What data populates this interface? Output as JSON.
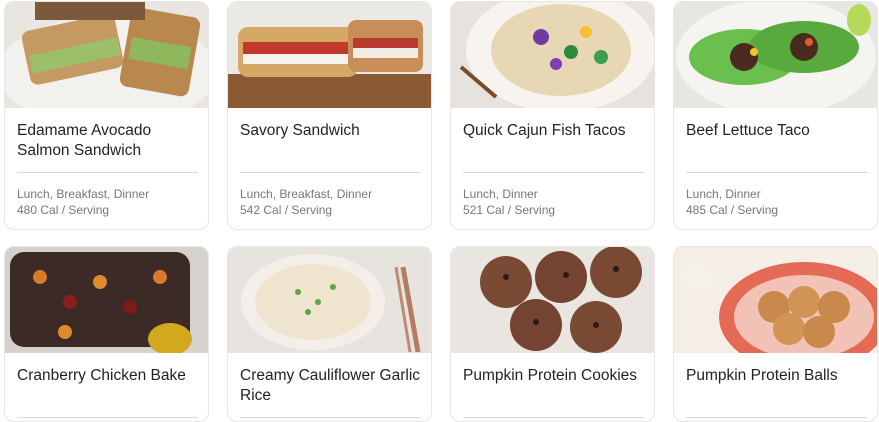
{
  "recipes": [
    {
      "title": "Edamame Avocado Salmon Sandwich",
      "categories": "Lunch, Breakfast, Dinner",
      "calories": "480 Cal / Serving",
      "image": "sandwich-photo"
    },
    {
      "title": "Savory Sandwich",
      "categories": "Lunch, Breakfast, Dinner",
      "calories": "542 Cal / Serving",
      "image": "sandwich-photo"
    },
    {
      "title": "Quick Cajun Fish Tacos",
      "categories": "Lunch, Dinner",
      "calories": "521 Cal / Serving",
      "image": "tacos-photo"
    },
    {
      "title": "Beef Lettuce Taco",
      "categories": "Lunch, Dinner",
      "calories": "485 Cal / Serving",
      "image": "lettuce-taco-photo"
    },
    {
      "title": "Cranberry Chicken Bake",
      "categories": "",
      "calories": "",
      "image": "bake-photo"
    },
    {
      "title": "Creamy Cauliflower Garlic Rice",
      "categories": "",
      "calories": "",
      "image": "rice-photo"
    },
    {
      "title": "Pumpkin Protein Cookies",
      "categories": "",
      "calories": "",
      "image": "cookies-photo"
    },
    {
      "title": "Pumpkin Protein Balls",
      "categories": "",
      "calories": "",
      "image": "balls-photo"
    }
  ]
}
